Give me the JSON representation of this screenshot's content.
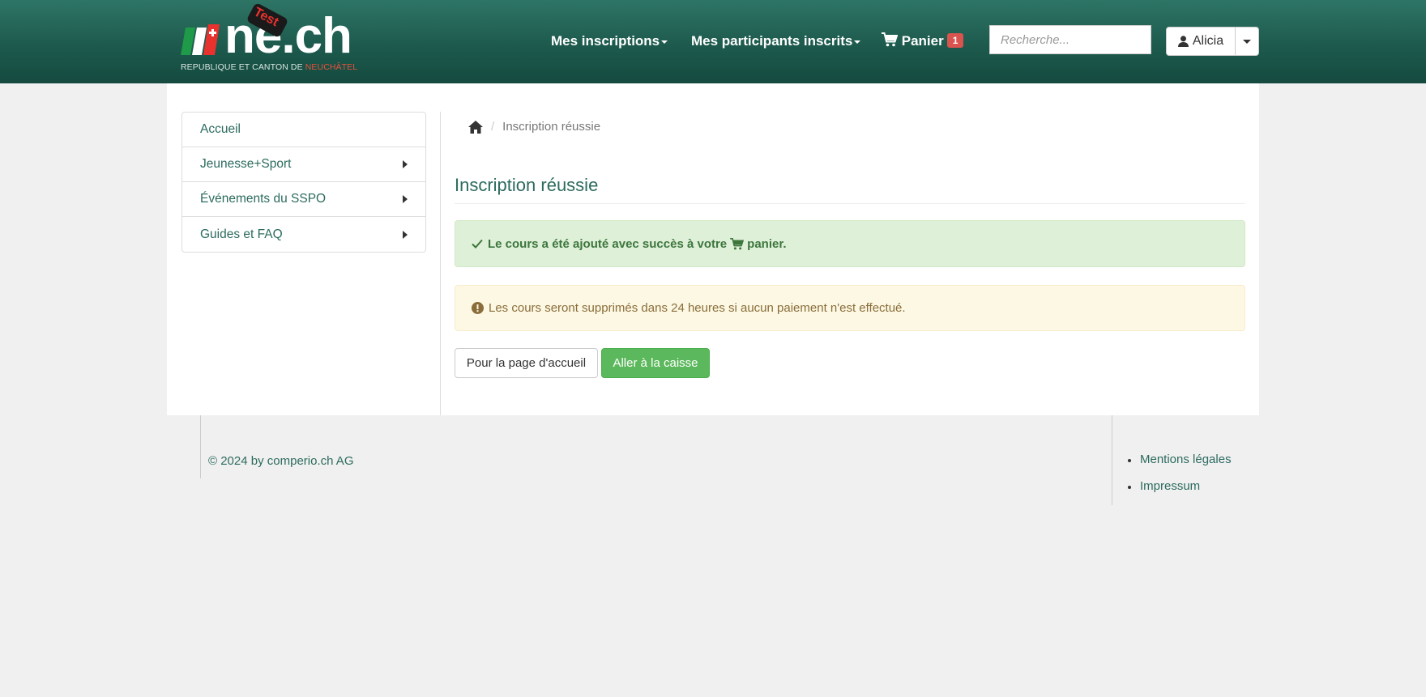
{
  "header": {
    "logo": {
      "brand": "ne.ch",
      "badge": "Test",
      "subtitle_prefix": "REPUBLIQUE ET CANTON DE ",
      "subtitle_highlight": "NEUCHÂTEL"
    },
    "nav": [
      {
        "label": "Mes inscriptions"
      },
      {
        "label": "Mes participants inscrits"
      },
      {
        "label": "Panier",
        "count": "1"
      }
    ],
    "search": {
      "placeholder": "Recherche..."
    },
    "user": {
      "name": "Alicia"
    }
  },
  "sidebar": {
    "items": [
      {
        "label": "Accueil",
        "has_submenu": false
      },
      {
        "label": "Jeunesse+Sport",
        "has_submenu": true
      },
      {
        "label": "Événements du SSPO",
        "has_submenu": true
      },
      {
        "label": "Guides et FAQ",
        "has_submenu": true
      }
    ]
  },
  "breadcrumb": {
    "current": "Inscription réussie"
  },
  "main": {
    "title": "Inscription réussie",
    "success": {
      "before": "Le cours a été ajouté avec succès à votre",
      "after": "panier."
    },
    "warning": "Les cours seront supprimés dans 24 heures si aucun paiement n'est effectué.",
    "buttons": {
      "home": "Pour la page d'accueil",
      "checkout": "Aller à la caisse"
    }
  },
  "footer": {
    "copyright": "© 2024 by comperio.ch AG",
    "links": [
      "Mentions légales",
      "Impressum"
    ]
  },
  "colors": {
    "header": "#1d5a4d",
    "link": "#2c6b5e",
    "success_bg": "#dff0d8",
    "warning_bg": "#fcf8e3",
    "primary_button": "#5cb85c",
    "badge": "#d9534f"
  }
}
